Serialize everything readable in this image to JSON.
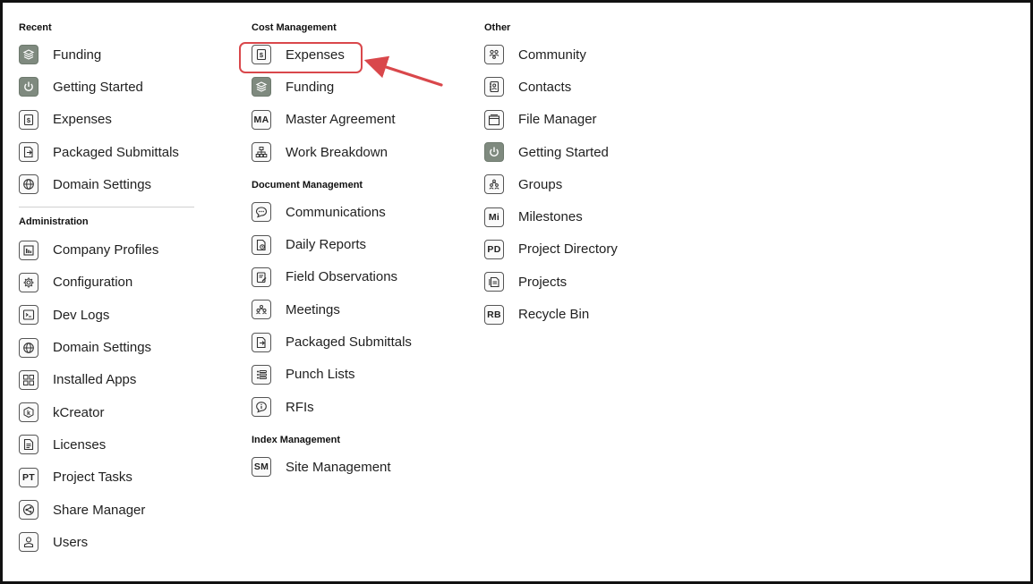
{
  "recent": {
    "title": "Recent",
    "items": [
      {
        "label": "Funding",
        "icon": "funding-icon"
      },
      {
        "label": "Getting Started",
        "icon": "power-icon"
      },
      {
        "label": "Expenses",
        "icon": "expenses-icon"
      },
      {
        "label": "Packaged Submittals",
        "icon": "packaged-submittals-icon"
      },
      {
        "label": "Domain Settings",
        "icon": "globe-icon"
      }
    ]
  },
  "administration": {
    "title": "Administration",
    "items": [
      {
        "label": "Company Profiles",
        "icon": "company-icon"
      },
      {
        "label": "Configuration",
        "icon": "gear-icon"
      },
      {
        "label": "Dev Logs",
        "icon": "terminal-icon"
      },
      {
        "label": "Domain Settings",
        "icon": "globe-icon"
      },
      {
        "label": "Installed Apps",
        "icon": "apps-icon"
      },
      {
        "label": "kCreator",
        "icon": "kcreator-icon"
      },
      {
        "label": "Licenses",
        "icon": "license-icon"
      },
      {
        "label": "Project Tasks",
        "icon": "pt-icon",
        "abbr": "PT"
      },
      {
        "label": "Share Manager",
        "icon": "share-icon"
      },
      {
        "label": "Users",
        "icon": "user-icon"
      }
    ]
  },
  "cost_management": {
    "title": "Cost Management",
    "items": [
      {
        "label": "Expenses",
        "icon": "expenses-icon"
      },
      {
        "label": "Funding",
        "icon": "funding-icon"
      },
      {
        "label": "Master Agreement",
        "icon": "ma-icon",
        "abbr": "MA"
      },
      {
        "label": "Work Breakdown",
        "icon": "work-breakdown-icon"
      }
    ]
  },
  "document_management": {
    "title": "Document Management",
    "items": [
      {
        "label": "Communications",
        "icon": "chat-icon"
      },
      {
        "label": "Daily Reports",
        "icon": "daily-report-icon"
      },
      {
        "label": "Field Observations",
        "icon": "field-observation-icon"
      },
      {
        "label": "Meetings",
        "icon": "meetings-icon"
      },
      {
        "label": "Packaged Submittals",
        "icon": "packaged-submittals-icon"
      },
      {
        "label": "Punch Lists",
        "icon": "list-icon"
      },
      {
        "label": "RFIs",
        "icon": "rfi-icon"
      }
    ]
  },
  "index_management": {
    "title": "Index Management",
    "items": [
      {
        "label": "Site Management",
        "icon": "sm-icon",
        "abbr": "SM"
      }
    ]
  },
  "other": {
    "title": "Other",
    "items": [
      {
        "label": "Community",
        "icon": "community-icon"
      },
      {
        "label": "Contacts",
        "icon": "contacts-icon"
      },
      {
        "label": "File Manager",
        "icon": "file-manager-icon"
      },
      {
        "label": "Getting Started",
        "icon": "power-icon"
      },
      {
        "label": "Groups",
        "icon": "groups-icon"
      },
      {
        "label": "Milestones",
        "icon": "mi-icon",
        "abbr": "Mi"
      },
      {
        "label": "Project Directory",
        "icon": "pd-icon",
        "abbr": "PD"
      },
      {
        "label": "Projects",
        "icon": "projects-icon"
      },
      {
        "label": "Recycle Bin",
        "icon": "rb-icon",
        "abbr": "RB"
      }
    ]
  },
  "colors": {
    "highlight": "#d9474b",
    "icon_fill": "#7f8a7f"
  }
}
